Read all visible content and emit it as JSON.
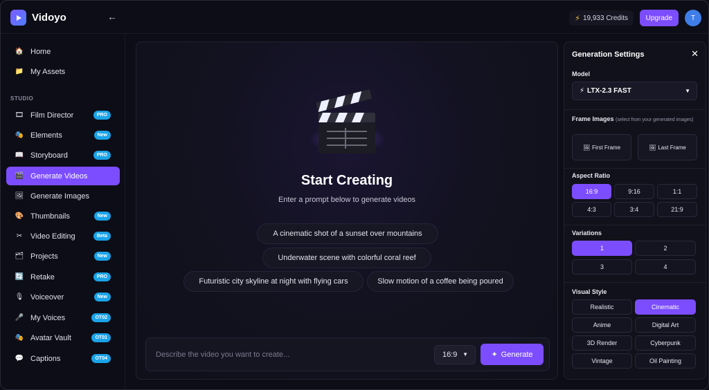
{
  "app": {
    "name": "Vidoyo",
    "collapse_icon": "←",
    "credits": "19,933 Credits",
    "upgrade_label": "Upgrade",
    "avatar_initial": "T"
  },
  "sidebar": {
    "top_items": [
      {
        "label": "Home",
        "icon": "🏠"
      },
      {
        "label": "My Assets",
        "icon": "📁"
      }
    ],
    "section_label": "STUDIO",
    "studio_items": [
      {
        "label": "Film Director",
        "icon": "🎞",
        "badge": "PRO"
      },
      {
        "label": "Elements",
        "icon": "🎭",
        "badge": "New"
      },
      {
        "label": "Storyboard",
        "icon": "📖",
        "badge": "PRO"
      },
      {
        "label": "Generate Videos",
        "icon": "🎬",
        "badge": ""
      },
      {
        "label": "Generate Images",
        "icon": "🖼",
        "badge": ""
      },
      {
        "label": "Thumbnails",
        "icon": "🎨",
        "badge": "New"
      },
      {
        "label": "Video Editing",
        "icon": "✂",
        "badge": "Beta"
      },
      {
        "label": "Projects",
        "icon": "🗂",
        "badge": "New"
      },
      {
        "label": "Retake",
        "icon": "🔄",
        "badge": "PRO"
      },
      {
        "label": "Voiceover",
        "icon": "🎙",
        "badge": "New"
      },
      {
        "label": "My Voices",
        "icon": "🎤",
        "badge": "OT02"
      },
      {
        "label": "Avatar Vault",
        "icon": "🎭",
        "badge": "OT01"
      },
      {
        "label": "Captions",
        "icon": "💬",
        "badge": "OT04"
      }
    ],
    "active": "Generate Videos"
  },
  "main": {
    "title": "Start Creating",
    "subtitle": "Enter a prompt below to generate videos",
    "suggestions": [
      "A cinematic shot of a sunset over mountains",
      "Underwater scene with colorful coral reef",
      "Futuristic city skyline at night with flying cars",
      "Slow motion of a coffee being poured"
    ],
    "prompt_placeholder": "Describe the video you want to create...",
    "ratio_value": "16:9",
    "generate_label": "Generate",
    "accent": "#7c4dff"
  },
  "settings": {
    "title": "Generation Settings",
    "close_icon": "✕",
    "model_label": "Model",
    "model_value": "LTX-2.3 FAST",
    "model_icon": "⚡",
    "frame_label": "Frame Images",
    "frame_hint": "(select from your generated images)",
    "first_frame": "First Frame",
    "last_frame": "Last Frame",
    "frame_icon": "🖼",
    "aspect_label": "Aspect Ratio",
    "aspect_options": [
      "16:9",
      "9:16",
      "1:1",
      "4:3",
      "3:4",
      "21:9"
    ],
    "aspect_selected": "16:9",
    "variations_label": "Variations",
    "variation_options": [
      "1",
      "2",
      "3",
      "4"
    ],
    "variation_selected": "1",
    "style_label": "Visual Style",
    "style_options": [
      "Realistic",
      "Cinematic",
      "Anime",
      "Digital Art",
      "3D Render",
      "Cyberpunk",
      "Vintage",
      "Oil Painting"
    ],
    "style_selected": "Cinematic"
  }
}
